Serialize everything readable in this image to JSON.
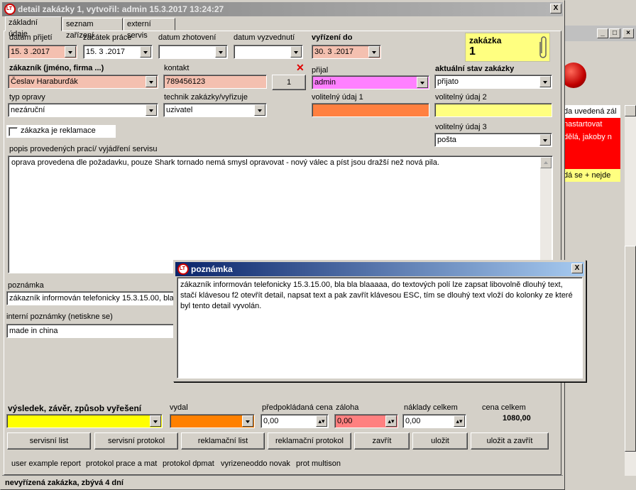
{
  "background_window": {
    "list_rows": [
      {
        "text": "da uvedená zál",
        "color": "#ffffff"
      },
      {
        "text": "nastartovat",
        "color": "#ff0000"
      },
      {
        "text": "dělá, jakoby n",
        "color": "#ff0000"
      },
      {
        "text": "",
        "color": "#ff0000"
      },
      {
        "text": "",
        "color": "#ff0000"
      },
      {
        "text": "dá se + nejde",
        "color": "#ffff80"
      }
    ]
  },
  "main": {
    "title": "detail zakázky 1, vytvořil: admin 15.3.2017 13:24:27",
    "close_glyph": "X",
    "tabs": [
      "základní údaje",
      "seznam zařízení",
      "externí servis"
    ],
    "fields": {
      "datum_prijeti": {
        "label": "datum přijetí",
        "value": "15. 3 .2017",
        "color": "#f4c0b0"
      },
      "zacatek_prace": {
        "label": "začátek práce",
        "value": "15. 3 .2017"
      },
      "datum_zhotoveni": {
        "label": "datum zhotovení",
        "value": ""
      },
      "datum_vyzvednuti": {
        "label": "datum vyzvednutí",
        "value": ""
      },
      "vyrizeni_do": {
        "label": "vyřízení do",
        "value": "30. 3 .2017",
        "color": "#f4c0b0"
      },
      "zakaznik": {
        "label": "zákazník (jméno, firma ...)",
        "value": "Česlav Haraburďák",
        "color": "#f4c0b0"
      },
      "kontakt": {
        "label": "kontakt",
        "value": "789456123",
        "color": "#f4c0b0"
      },
      "kontakt_count": "1",
      "prijal": {
        "label": "přijal",
        "value": "admin",
        "color": "#ff80ff"
      },
      "stav": {
        "label": "aktuální stav zakázky",
        "value": "přijato"
      },
      "typ_opravy": {
        "label": "typ opravy",
        "value": "nezáruční"
      },
      "technik": {
        "label": "technik zakázky/vyřizuje",
        "value": "uzivatel"
      },
      "volitelny1": {
        "label": "volitelný údaj 1",
        "value": "",
        "color": "#ff8040"
      },
      "volitelny2": {
        "label": "volitelný údaj 2",
        "value": "",
        "color": "#ffff80"
      },
      "volitelny3": {
        "label": "volitelný údaj 3",
        "value": "pošta"
      },
      "reklamace": {
        "label": "zákazka je reklamace",
        "checked": false
      },
      "popis": {
        "label": "popis provedených prací/ vyjádření servisu",
        "value": "oprava provedena dle požadavku, pouze Shark tornado nemá smysl opravovat - nový válec a píst jsou dražší než nová pila."
      },
      "poznamka": {
        "label": "poznámka",
        "value": "zákazník informován telefonicky 15.3.15.00, bla"
      },
      "interni": {
        "label": "interní poznámky (netiskne se)",
        "value": "made in china"
      },
      "vysledek": {
        "label": "výsledek, závěr, způsob vyřešení",
        "value": "",
        "color": "#ffff00"
      },
      "vydal": {
        "label": "vydal",
        "value": "",
        "color": "#ff8000"
      },
      "predpokladana_cena": {
        "label": "předpokládaná cena",
        "value": "0,00"
      },
      "zaloha": {
        "label": "záloha",
        "value": "0,00",
        "color": "#ff8080"
      },
      "naklady": {
        "label": "náklady celkem",
        "value": "0,00"
      },
      "cena_celkem": {
        "label": "cena celkem",
        "value": "1080,00"
      }
    },
    "order_box": {
      "label": "zakázka",
      "number": "1",
      "color": "#ffff80"
    },
    "buttons": [
      "servisní list",
      "servisní protokol",
      "reklamační list",
      "reklamační protokol",
      "zavřít",
      "uložit",
      "uložit a zavřít"
    ],
    "report_links": [
      "user example report",
      "protokol prace a mat",
      "protokol dpmat",
      "vyrizeneoddo novak",
      "prot multison"
    ],
    "status": "nevyřízená zakázka, zbývá 4 dní"
  },
  "popup": {
    "title": "poznámka",
    "close_glyph": "X",
    "text": "zákazník informován telefonicky 15.3.15.00, bla bla blaaaaa,      do textových polí lze zapsat libovolně dlouhý text, stačí klávesou f2 otevřít detail, napsat text  a pak zavřít klávesou ESC, tím se dlouhý text vloží do kolonky ze které byl tento detail vyvolán."
  }
}
